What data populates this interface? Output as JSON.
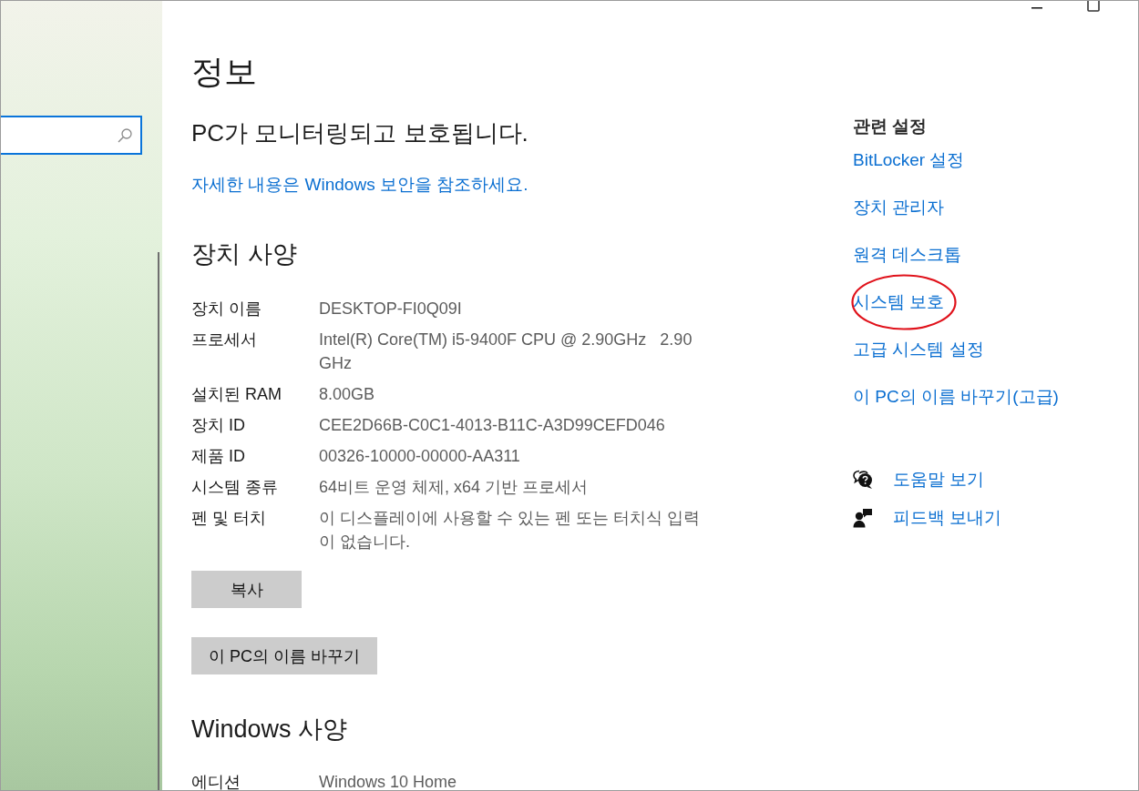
{
  "page": {
    "title": "정보",
    "protection_status": "PC가 모니터링되고 보호됩니다.",
    "security_link": "자세한 내용은 Windows 보안을 참조하세요."
  },
  "device_specs": {
    "heading": "장치 사양",
    "rows": [
      {
        "label": "장치 이름",
        "value": "DESKTOP-FI0Q09I"
      },
      {
        "label": "프로세서",
        "value": "Intel(R) Core(TM) i5-9400F CPU @ 2.90GHz   2.90 GHz"
      },
      {
        "label": "설치된 RAM",
        "value": "8.00GB"
      },
      {
        "label": "장치 ID",
        "value": "CEE2D66B-C0C1-4013-B11C-A3D99CEFD046"
      },
      {
        "label": "제품 ID",
        "value": "00326-10000-00000-AA311"
      },
      {
        "label": "시스템 종류",
        "value": "64비트 운영 체제, x64 기반 프로세서"
      },
      {
        "label": "펜 및 터치",
        "value": "이 디스플레이에 사용할 수 있는 펜 또는 터치식 입력이 없습니다."
      }
    ],
    "buttons": [
      "복사",
      "이 PC의 이름 바꾸기"
    ]
  },
  "windows_specs": {
    "heading": "Windows 사양",
    "rows": [
      {
        "label": "에디션",
        "value": "Windows 10 Home"
      }
    ]
  },
  "related_settings": {
    "heading": "관련 설정",
    "links": [
      {
        "label": "BitLocker 설정",
        "circled": false
      },
      {
        "label": "장치 관리자",
        "circled": false
      },
      {
        "label": "원격 데스크톱",
        "circled": false
      },
      {
        "label": "시스템 보호",
        "circled": true
      },
      {
        "label": "고급 시스템 설정",
        "circled": false
      },
      {
        "label": "이 PC의 이름 바꾸기(고급)",
        "circled": false
      }
    ]
  },
  "help_links": [
    {
      "kind": "help",
      "label": "도움말 보기"
    },
    {
      "kind": "feedback",
      "label": "피드백 보내기"
    }
  ]
}
